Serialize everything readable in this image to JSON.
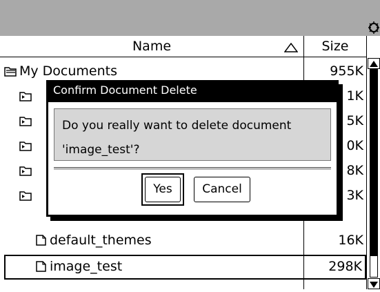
{
  "header": {
    "name_label": "Name",
    "size_label": "Size"
  },
  "rows": [
    {
      "name": "My Documents",
      "size": "955K",
      "type": "folder-open"
    },
    {
      "name": "",
      "size": "1K",
      "type": "folder"
    },
    {
      "name": "",
      "size": "5K",
      "type": "folder"
    },
    {
      "name": "",
      "size": "0K",
      "type": "folder"
    },
    {
      "name": "",
      "size": "8K",
      "type": "folder"
    },
    {
      "name": "",
      "size": "3K",
      "type": "folder"
    },
    {
      "name": "default_themes",
      "size": "16K",
      "type": "document"
    },
    {
      "name": "image_test",
      "size": "298K",
      "type": "document",
      "selected": true
    }
  ],
  "dialog": {
    "title": "Confirm Document Delete",
    "message_line1": "Do you really want to delete document",
    "message_line2": "'image_test'?",
    "yes_label": "Yes",
    "cancel_label": "Cancel"
  },
  "icons": {
    "settings": "gear-icon",
    "sort": "sort-ascending-icon",
    "folder": "folder-icon",
    "document": "document-icon"
  }
}
